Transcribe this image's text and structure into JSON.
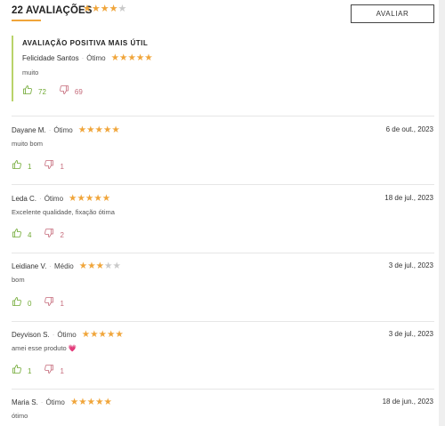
{
  "header": {
    "title": "22 AVALIAÇÕES",
    "average_stars": 4,
    "max_stars": 5,
    "evaluate_label": "AVALIAR"
  },
  "featured": {
    "heading": "AVALIAÇÃO POSITIVA MAIS ÚTIL",
    "author": "Felicidade Santos",
    "rating_word": "Ótimo",
    "stars": 5,
    "text": "muito",
    "helpful": "72",
    "not_helpful": "69"
  },
  "reviews": [
    {
      "author": "Dayane M.",
      "rating_word": "Ótimo",
      "stars": 5,
      "date": "6 de out., 2023",
      "text": "muito bom",
      "helpful": "1",
      "not_helpful": "1"
    },
    {
      "author": "Leda C.",
      "rating_word": "Ótimo",
      "stars": 5,
      "date": "18 de jul., 2023",
      "text": "Excelente qualidade, fixação ótima",
      "helpful": "4",
      "not_helpful": "2"
    },
    {
      "author": "Leidiane V.",
      "rating_word": "Médio",
      "stars": 3,
      "date": "3 de jul., 2023",
      "text": "bom",
      "helpful": "0",
      "not_helpful": "1"
    },
    {
      "author": "Deyvison S.",
      "rating_word": "Ótimo",
      "stars": 5,
      "date": "3 de jul., 2023",
      "text": "amei esse produto",
      "text_emoji": "💗",
      "helpful": "1",
      "not_helpful": "1"
    },
    {
      "author": "Maria S.",
      "rating_word": "Ótimo",
      "stars": 5,
      "date": "18 de jun., 2023",
      "text": "ótimo"
    }
  ],
  "colors": {
    "star_on": "#f0a53a",
    "star_off": "#c9c9c9",
    "accent_underline": "#f0a53a",
    "featured_border": "#b9d36a",
    "thumb_up": "#6fa832",
    "thumb_down": "#c56a7a"
  },
  "icons": {
    "star": "star-icon",
    "thumb_up": "thumbs-up-icon",
    "thumb_down": "thumbs-down-icon"
  }
}
